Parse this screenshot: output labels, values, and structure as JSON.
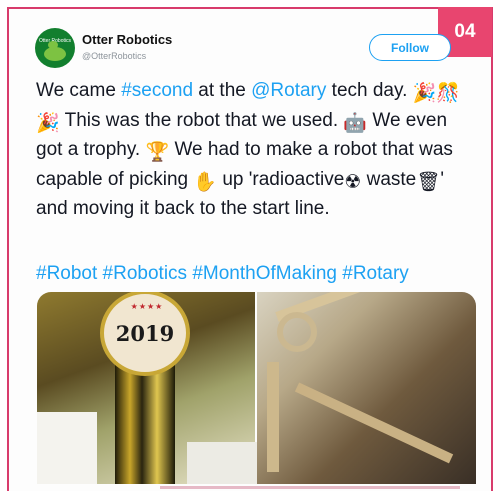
{
  "badge": "04",
  "account": {
    "avatar_text": "Otter Robotics",
    "name": "Otter Robotics",
    "handle": "@OtterRobotics"
  },
  "follow_label": "Follow",
  "tweet": {
    "p1": "We came ",
    "link1": "#second",
    "p2": " at the ",
    "link2": "@Rotary",
    "p3": " tech day. ",
    "p4": " This was the robot that we used. ",
    "p5": " We even got a trophy. ",
    "p6": " We had to make a robot that was capable of picking ",
    "p7": " up 'radioactive",
    "p8": " waste",
    "p9": "' and moving it back to the start line."
  },
  "hashtags": "#Robot #Robotics #MonthOfMaking #Rotary",
  "photo_left": {
    "trophy_text": "2019",
    "stars": "★★★★"
  },
  "icons": {
    "party": "party-popper-icon",
    "robot": "robot-face-icon",
    "trophy": "trophy-icon",
    "hand": "raised-hand-icon",
    "radioactive": "radioactive-icon",
    "wastebasket": "wastebasket-icon"
  },
  "colors": {
    "accent": "#e8456f",
    "link": "#1da1f2",
    "avatar": "#127f2e"
  }
}
